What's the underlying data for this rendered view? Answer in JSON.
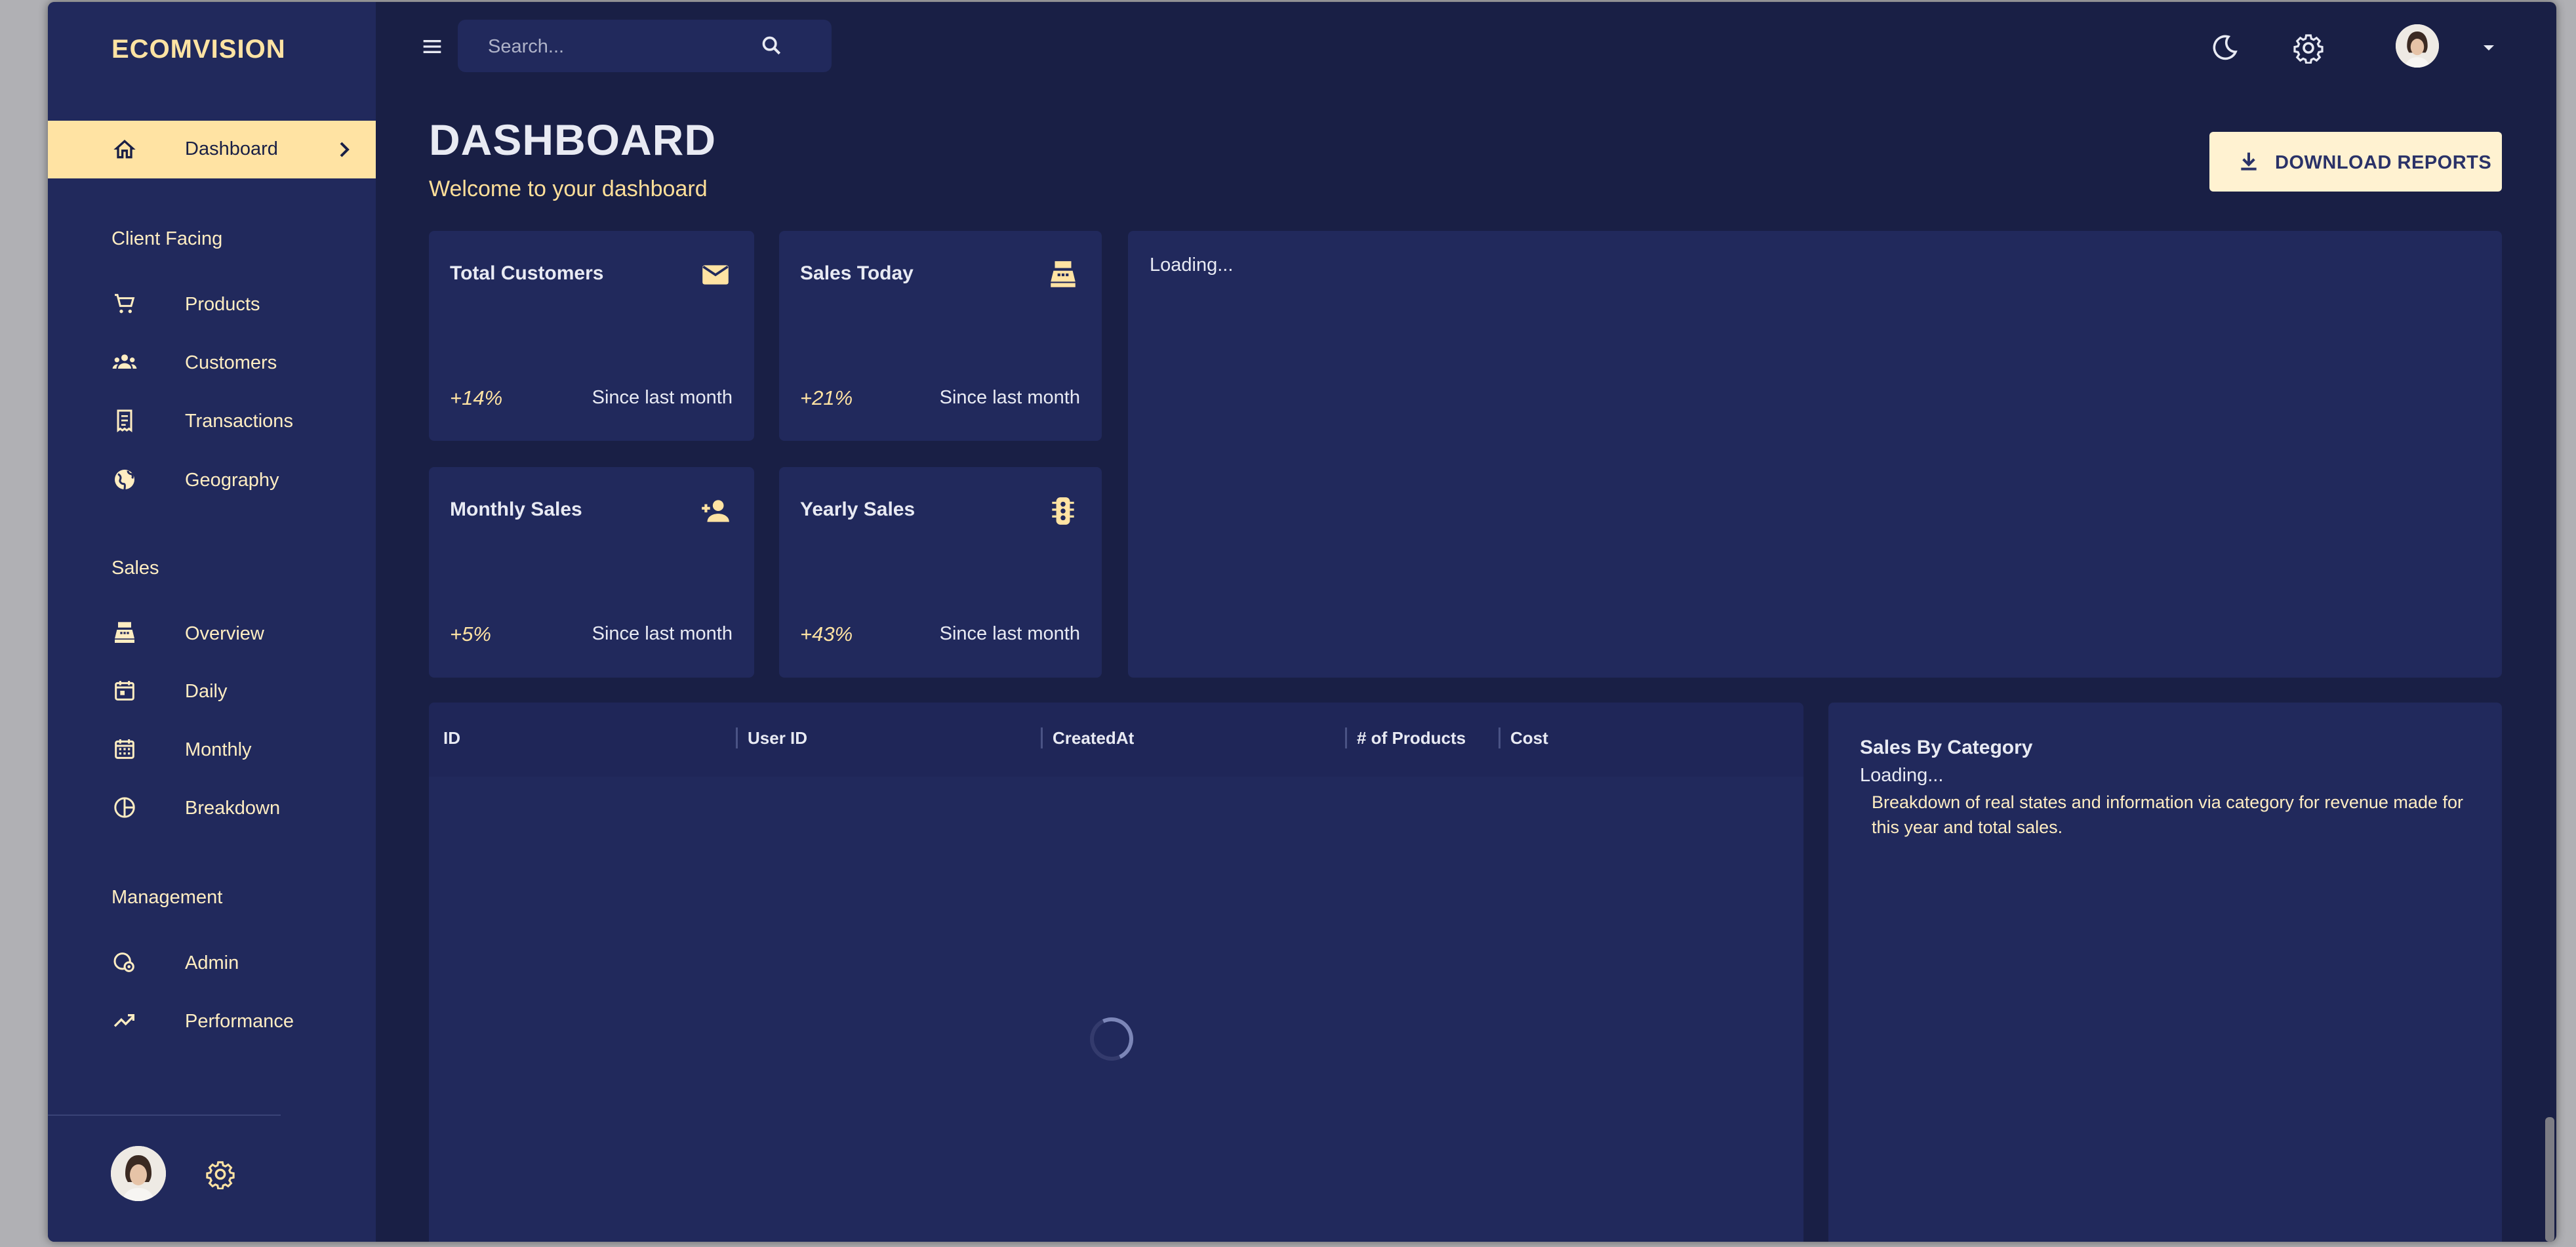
{
  "brand": "ECOMVISION",
  "colors": {
    "background": "#191f45",
    "panel": "#21295c",
    "accent": "#ffe3a3",
    "text": "#e8eaf3"
  },
  "sidebar": {
    "active": {
      "label": "Dashboard",
      "icon": "home-icon"
    },
    "sections": [
      {
        "title": "Client Facing",
        "items": [
          {
            "label": "Products",
            "icon": "shopping-cart-icon"
          },
          {
            "label": "Customers",
            "icon": "groups-icon"
          },
          {
            "label": "Transactions",
            "icon": "receipt-icon"
          },
          {
            "label": "Geography",
            "icon": "globe-icon"
          }
        ]
      },
      {
        "title": "Sales",
        "items": [
          {
            "label": "Overview",
            "icon": "point-of-sale-icon"
          },
          {
            "label": "Daily",
            "icon": "calendar-today-icon"
          },
          {
            "label": "Monthly",
            "icon": "calendar-month-icon"
          },
          {
            "label": "Breakdown",
            "icon": "pie-chart-icon"
          }
        ]
      },
      {
        "title": "Management",
        "items": [
          {
            "label": "Admin",
            "icon": "admin-icon"
          },
          {
            "label": "Performance",
            "icon": "trending-up-icon"
          }
        ]
      }
    ]
  },
  "topbar": {
    "search_placeholder": "Search...",
    "icons": [
      "menu-icon",
      "search-icon",
      "dark-mode-icon",
      "settings-icon",
      "avatar",
      "arrow-drop-down-icon"
    ]
  },
  "header": {
    "title": "DASHBOARD",
    "subtitle": "Welcome to your dashboard",
    "download_label": "DOWNLOAD REPORTS"
  },
  "stats": [
    {
      "title": "Total Customers",
      "increase": "+14%",
      "description": "Since last month",
      "icon": "email-icon"
    },
    {
      "title": "Sales Today",
      "increase": "+21%",
      "description": "Since last month",
      "icon": "point-of-sale-icon"
    },
    {
      "title": "Monthly Sales",
      "increase": "+5%",
      "description": "Since last month",
      "icon": "person-add-icon"
    },
    {
      "title": "Yearly Sales",
      "increase": "+43%",
      "description": "Since last month",
      "icon": "traffic-icon"
    }
  ],
  "overview_chart": {
    "status": "Loading..."
  },
  "transactions_table": {
    "columns": [
      "ID",
      "User ID",
      "CreatedAt",
      "# of Products",
      "Cost"
    ],
    "rows": [],
    "loading": true
  },
  "sales_by_category": {
    "title": "Sales By Category",
    "status": "Loading...",
    "description": "Breakdown of real states and information via category for revenue made for this year and total sales."
  }
}
